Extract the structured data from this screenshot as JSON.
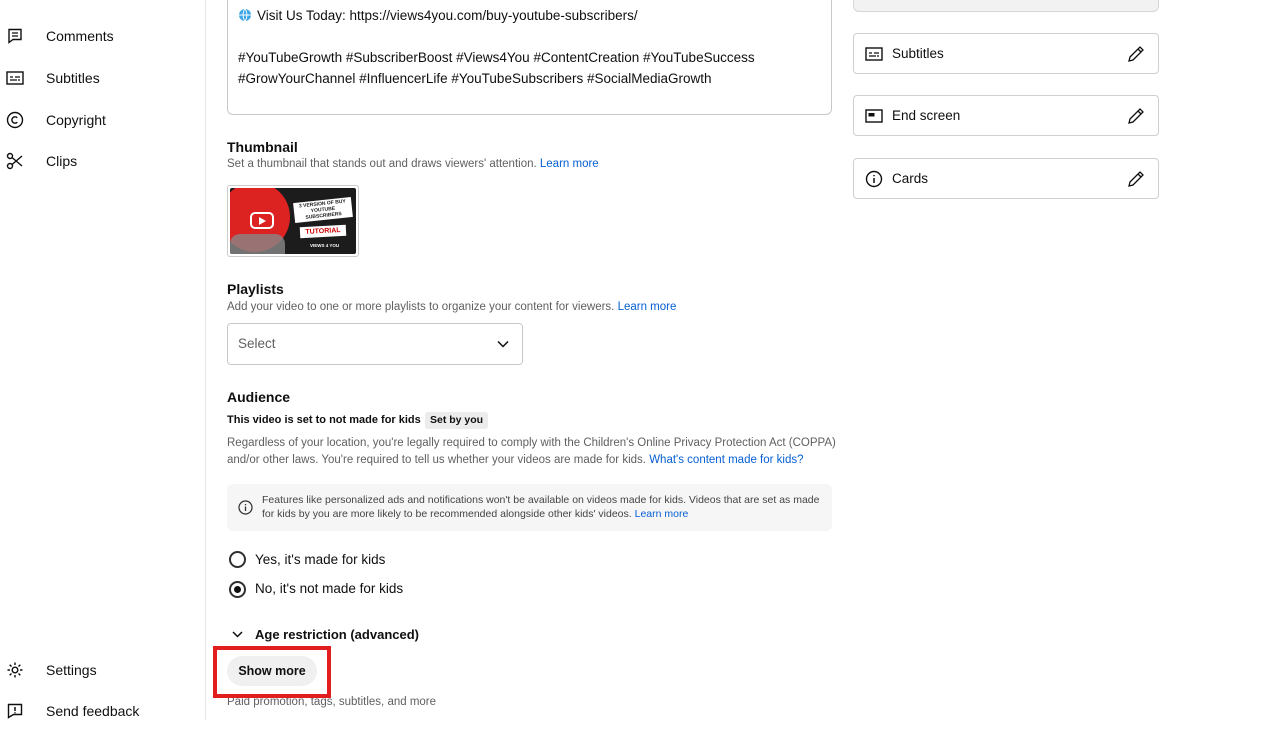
{
  "sidebar": {
    "items": [
      {
        "label": "Comments",
        "icon": "comments-icon"
      },
      {
        "label": "Subtitles",
        "icon": "subtitles-icon"
      },
      {
        "label": "Copyright",
        "icon": "copyright-icon"
      },
      {
        "label": "Clips",
        "icon": "scissors-icon"
      }
    ],
    "bottom": [
      {
        "label": "Settings",
        "icon": "gear-icon"
      },
      {
        "label": "Send feedback",
        "icon": "feedback-icon"
      }
    ]
  },
  "description": {
    "visit_line": "Visit Us Today:  https://views4you.com/buy-youtube-subscribers/",
    "tags_line1": "#YouTubeGrowth #SubscriberBoost #Views4You #ContentCreation #YouTubeSuccess",
    "tags_line2": "#GrowYourChannel #InfluencerLife #YouTubeSubscribers #SocialMediaGrowth"
  },
  "thumbnail": {
    "title": "Thumbnail",
    "subtitle": "Set a thumbnail that stands out and draws viewers' attention.",
    "learn_more": "Learn more",
    "image_text": {
      "line1": "3 VERSION OF BUY",
      "line2": "YOUTUBE SUBSCRIBERS",
      "tag": "TUTORIAL",
      "brand": "VIEWS 4 YOU"
    }
  },
  "playlists": {
    "title": "Playlists",
    "subtitle": "Add your video to one or more playlists to organize your content for viewers.",
    "learn_more": "Learn more",
    "select_value": "Select"
  },
  "audience": {
    "title": "Audience",
    "status": "This video is set to not made for kids",
    "badge": "Set by you",
    "legal_line1": "Regardless of your location, you're legally required to comply with the Children's Online Privacy Protection Act (COPPA)",
    "legal_line2": "and/or other laws. You're required to tell us whether your videos are made for kids.",
    "legal_link": "What's content made for kids?",
    "info_text": "Features like personalized ads and notifications won't be available on videos made for kids. Videos that are set as made for kids by you are more likely to be recommended alongside other kids' videos.",
    "info_link": "Learn more",
    "option_yes": "Yes, it's made for kids",
    "option_no": "No, it's not made for kids",
    "selected": "no"
  },
  "age_restriction": {
    "label": "Age restriction (advanced)"
  },
  "show_more": {
    "label": "Show more",
    "caption": "Paid promotion, tags, subtitles, and more"
  },
  "right_panel": {
    "items": [
      {
        "label": "Subtitles",
        "icon": "subtitles-icon"
      },
      {
        "label": "End screen",
        "icon": "end-screen-icon"
      },
      {
        "label": "Cards",
        "icon": "info-icon"
      }
    ]
  },
  "colors": {
    "link": "#065fd4",
    "highlight": "#e11d1d"
  }
}
